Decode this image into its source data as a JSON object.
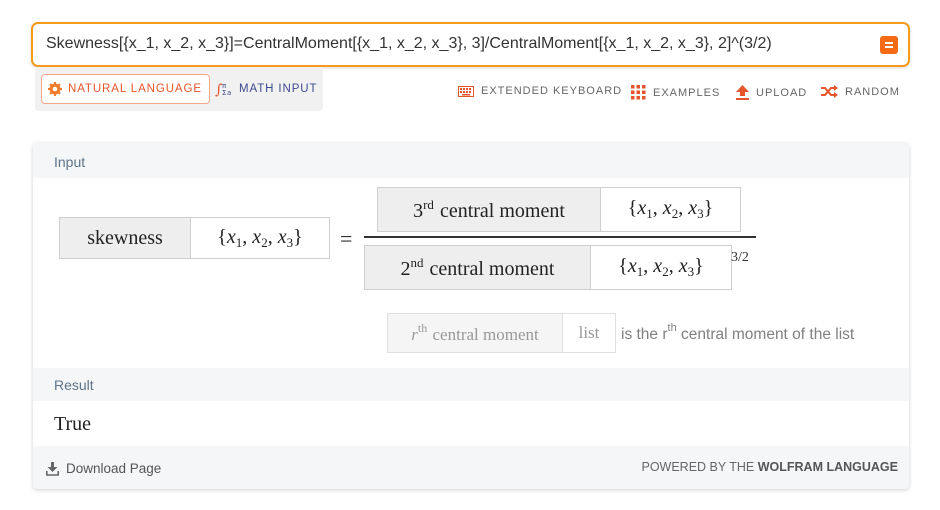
{
  "query": {
    "text": "Skewness[{x_1, x_2, x_3}]=CentralMoment[{x_1, x_2, x_3}, 3]/CentralMoment[{x_1, x_2, x_3}, 2]^(3/2)",
    "submit_icon": "equals-icon",
    "accent_color": "#f49b1c"
  },
  "mode_tabs": {
    "natural_language": "NATURAL LANGUAGE",
    "math_input": "MATH INPUT",
    "active": "natural_language"
  },
  "toolbar": {
    "extended_keyboard": "EXTENDED KEYBOARD",
    "examples": "EXAMPLES",
    "upload": "UPLOAD",
    "random": "RANDOM"
  },
  "input_pod": {
    "title": "Input",
    "lhs_function": "skewness",
    "argument_list": "{x1, x2, x3}",
    "equals": "=",
    "numerator": {
      "ordinal": "3",
      "ordinal_suffix": "rd",
      "label": "central moment"
    },
    "denominator": {
      "ordinal": "2",
      "ordinal_suffix": "nd",
      "label": "central moment"
    },
    "exponent": "3/2",
    "hint": {
      "symbol": "r",
      "symbol_suffix": "th",
      "label": "central moment",
      "argument": "list",
      "description_prefix": "is the",
      "description_symbol": "r",
      "description_suffix": "th",
      "description_rest": "central moment of the list"
    }
  },
  "result_pod": {
    "title": "Result",
    "value": "True"
  },
  "footer": {
    "download": "Download Page",
    "powered_prefix": "POWERED BY THE",
    "powered_brand": "WOLFRAM LANGUAGE"
  }
}
